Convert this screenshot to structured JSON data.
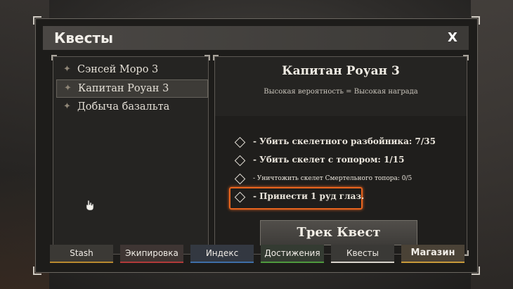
{
  "window": {
    "title": "Квесты",
    "close_label": "X"
  },
  "quest_list": [
    {
      "label": "Сэнсей Моро 3",
      "selected": false
    },
    {
      "label": "Капитан Роуан 3",
      "selected": true
    },
    {
      "label": "Добыча базальта",
      "selected": false
    }
  ],
  "quest_detail": {
    "title": "Капитан Роуан 3",
    "subtitle": "Высокая вероятность = Высокая награда",
    "objectives": [
      {
        "text": "- Убить скелетного разбойника: 7/35"
      },
      {
        "text": "- Убить скелет с топором: 1/15"
      },
      {
        "text": "- Уничтожить скелет Смертельного топора: 0/5"
      },
      {
        "text": "- Принести 1 руд глаз.",
        "highlighted": true
      }
    ],
    "track_button": "Трек Квест"
  },
  "nav": [
    {
      "label": "Stash",
      "color": "#b98a2f"
    },
    {
      "label": "Экипировка",
      "color": "#b23a3a"
    },
    {
      "label": "Индекс",
      "color": "#3f6fa8"
    },
    {
      "label": "Достижения",
      "color": "#4f9a3e"
    },
    {
      "label": "Квесты",
      "color": "#d8d4cc"
    },
    {
      "label": "Магазин",
      "color": "#c89a3a"
    }
  ],
  "accent_color": "#e8641e"
}
